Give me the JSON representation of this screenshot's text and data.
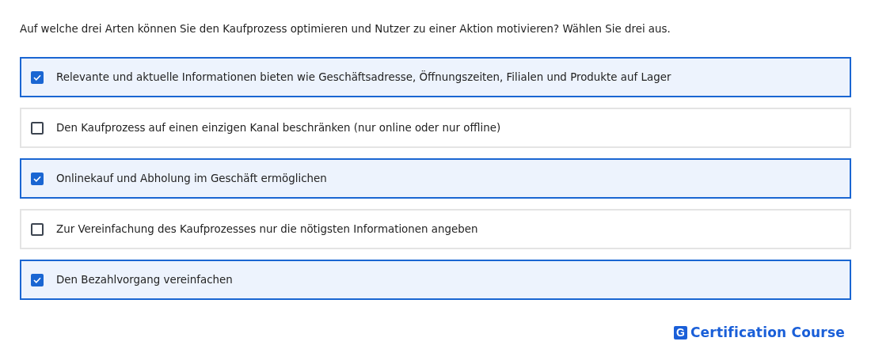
{
  "question": "Auf welche drei Arten können Sie den Kaufprozess optimieren und Nutzer zu einer Aktion motivieren? Wählen Sie drei aus.",
  "options": [
    {
      "label": "Relevante und aktuelle Informationen bieten wie Geschäftsadresse, Öffnungszeiten, Filialen und Produkte auf Lager",
      "checked": true
    },
    {
      "label": "Den Kaufprozess auf einen einzigen Kanal beschränken (nur online oder nur offline)",
      "checked": false
    },
    {
      "label": "Onlinekauf und Abholung im Geschäft ermöglichen",
      "checked": true
    },
    {
      "label": "Zur Vereinfachung des Kaufprozesses nur die nötigsten Informationen angeben",
      "checked": false
    },
    {
      "label": "Den Bezahlvorgang vereinfachen",
      "checked": true
    }
  ],
  "logo": {
    "mark": "G",
    "text": "Certification Course"
  }
}
